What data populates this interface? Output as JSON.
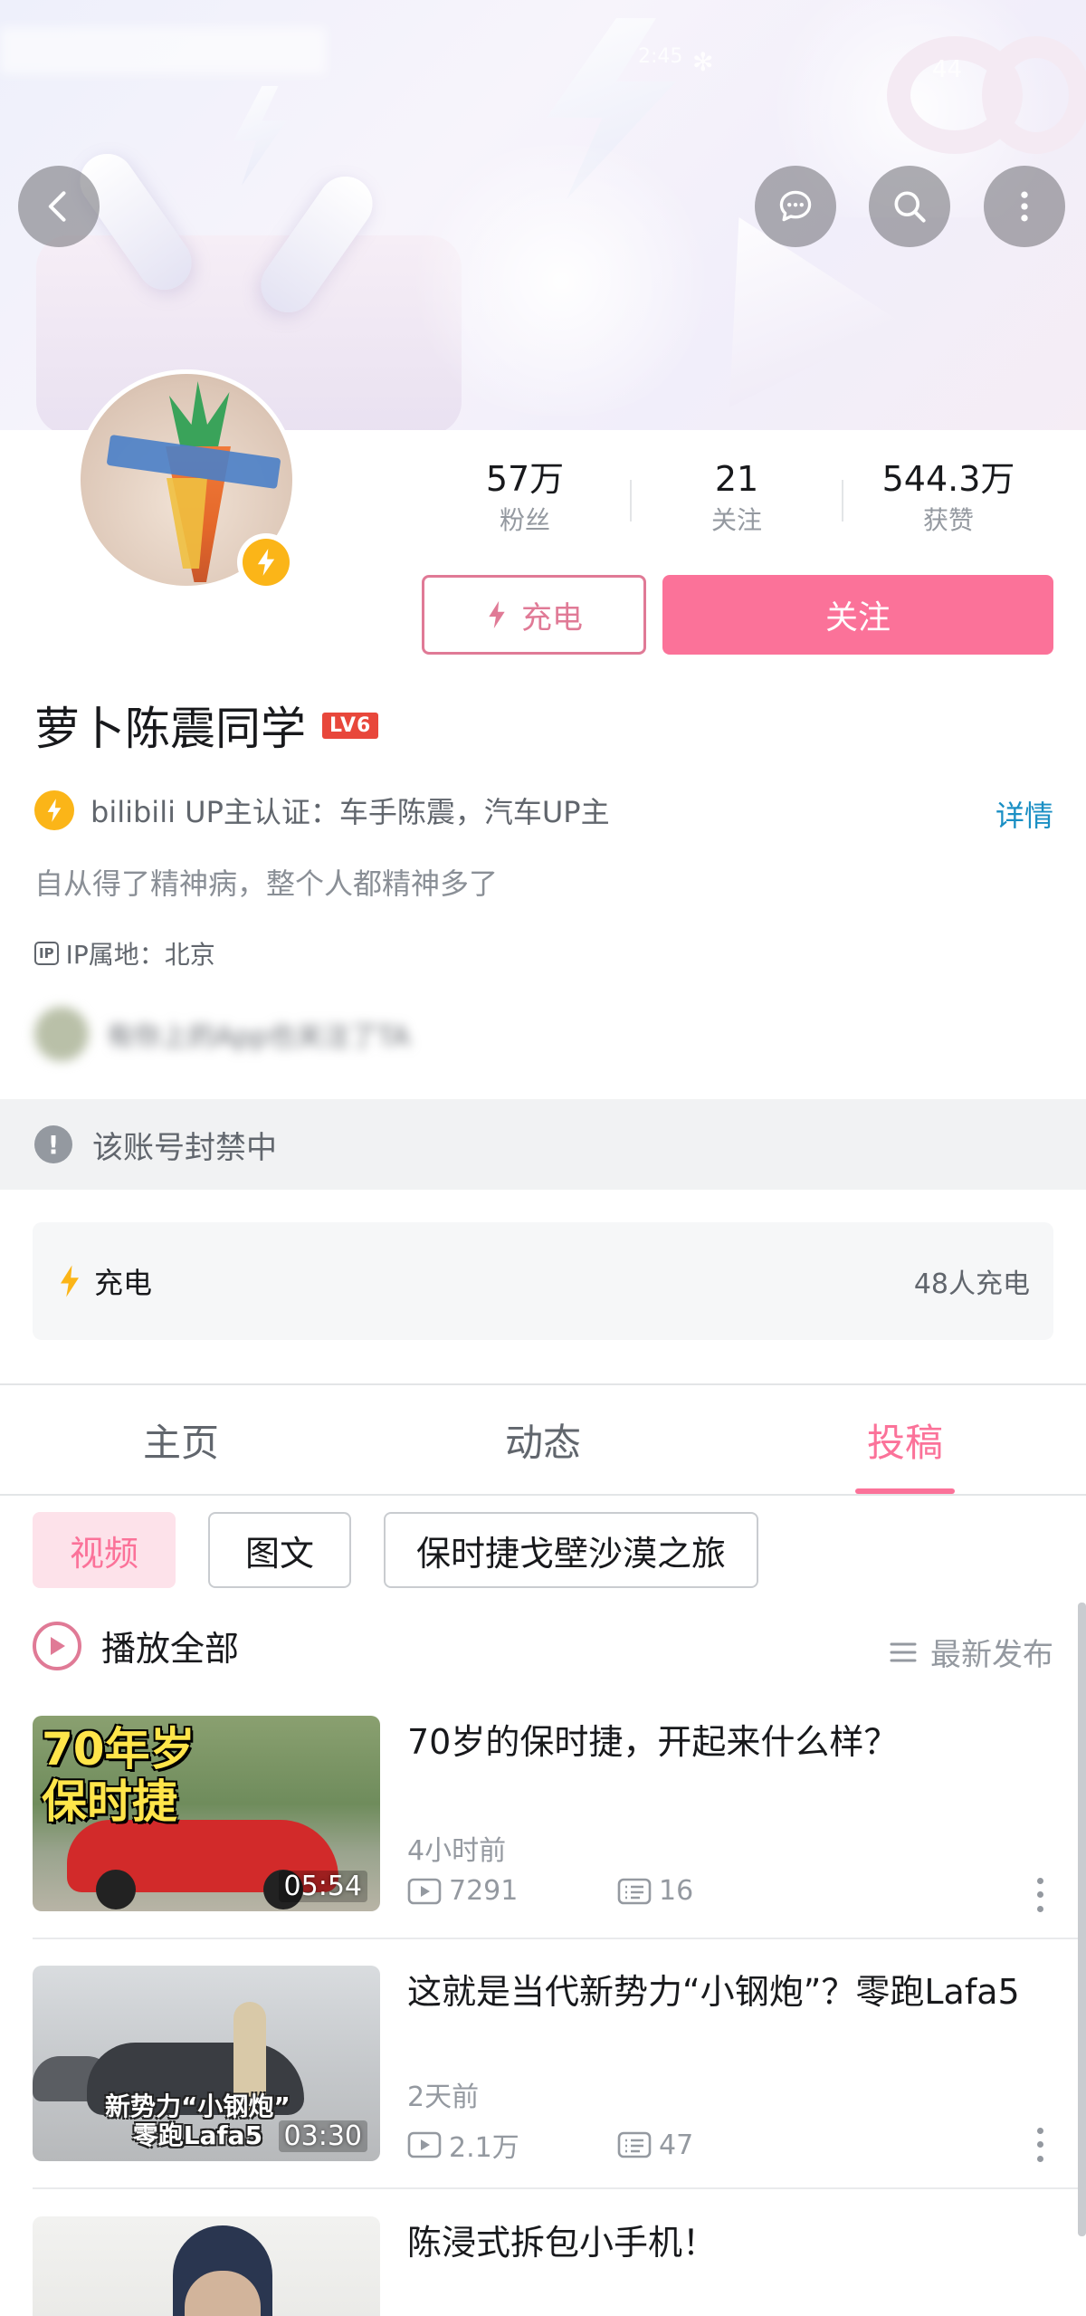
{
  "status_bar": {
    "time": "2:45",
    "battery": "44"
  },
  "profile": {
    "stats": [
      {
        "value": "57万",
        "label": "粉丝"
      },
      {
        "value": "21",
        "label": "关注"
      },
      {
        "value": "544.3万",
        "label": "获赞"
      }
    ],
    "charge_button_label": "充电",
    "follow_button_label": "关注",
    "name": "萝卜陈震同学",
    "level": "LV6",
    "verification": "bilibili UP主认证：车手陈震，汽车UP主",
    "detail_link": "详情",
    "bio": "自从得了精神病，整个人都精神多了",
    "ip_tag": "IP",
    "ip_location": "IP属地：北京",
    "blurred_follow_note": "有你上的App也关注了TA"
  },
  "banned_notice": "该账号封禁中",
  "charge_card": {
    "title": "充电",
    "count_text": "48人充电"
  },
  "tabs": [
    {
      "label": "主页",
      "active": false
    },
    {
      "label": "动态",
      "active": false
    },
    {
      "label": "投稿",
      "active": true
    }
  ],
  "filter_chips": [
    {
      "label": "视频",
      "active": true
    },
    {
      "label": "图文",
      "active": false
    },
    {
      "label": "保时捷戈壁沙漠之旅",
      "active": false
    }
  ],
  "play_all_label": "播放全部",
  "sort_label": "最新发布",
  "videos": [
    {
      "title": "70岁的保时捷，开起来什么样？",
      "time": "4小时前",
      "views": "7291",
      "comments": "16",
      "duration": "05:54",
      "thumb_caption": "70年岁\n保时捷"
    },
    {
      "title": "这就是当代新势力“小钢炮”？零跑Lafa5",
      "time": "2天前",
      "views": "2.1万",
      "comments": "47",
      "duration": "03:30",
      "thumb_caption": "新势力“小钢炮”\n零跑Lafa5"
    },
    {
      "title": "陈浸式拆包小手机！",
      "time": "",
      "views": "",
      "comments": "",
      "duration": "",
      "thumb_caption": ""
    }
  ],
  "colors": {
    "accent_pink": "#fb7299",
    "charge_yellow": "#fbb518",
    "link_blue": "#1a8fc4",
    "level_red": "#e8473b"
  },
  "icons": [
    "back-icon",
    "message-icon",
    "search-icon",
    "more-icon",
    "lightning-icon",
    "play-circle-icon",
    "sort-list-icon",
    "view-count-icon",
    "comment-count-icon",
    "alert-icon"
  ]
}
